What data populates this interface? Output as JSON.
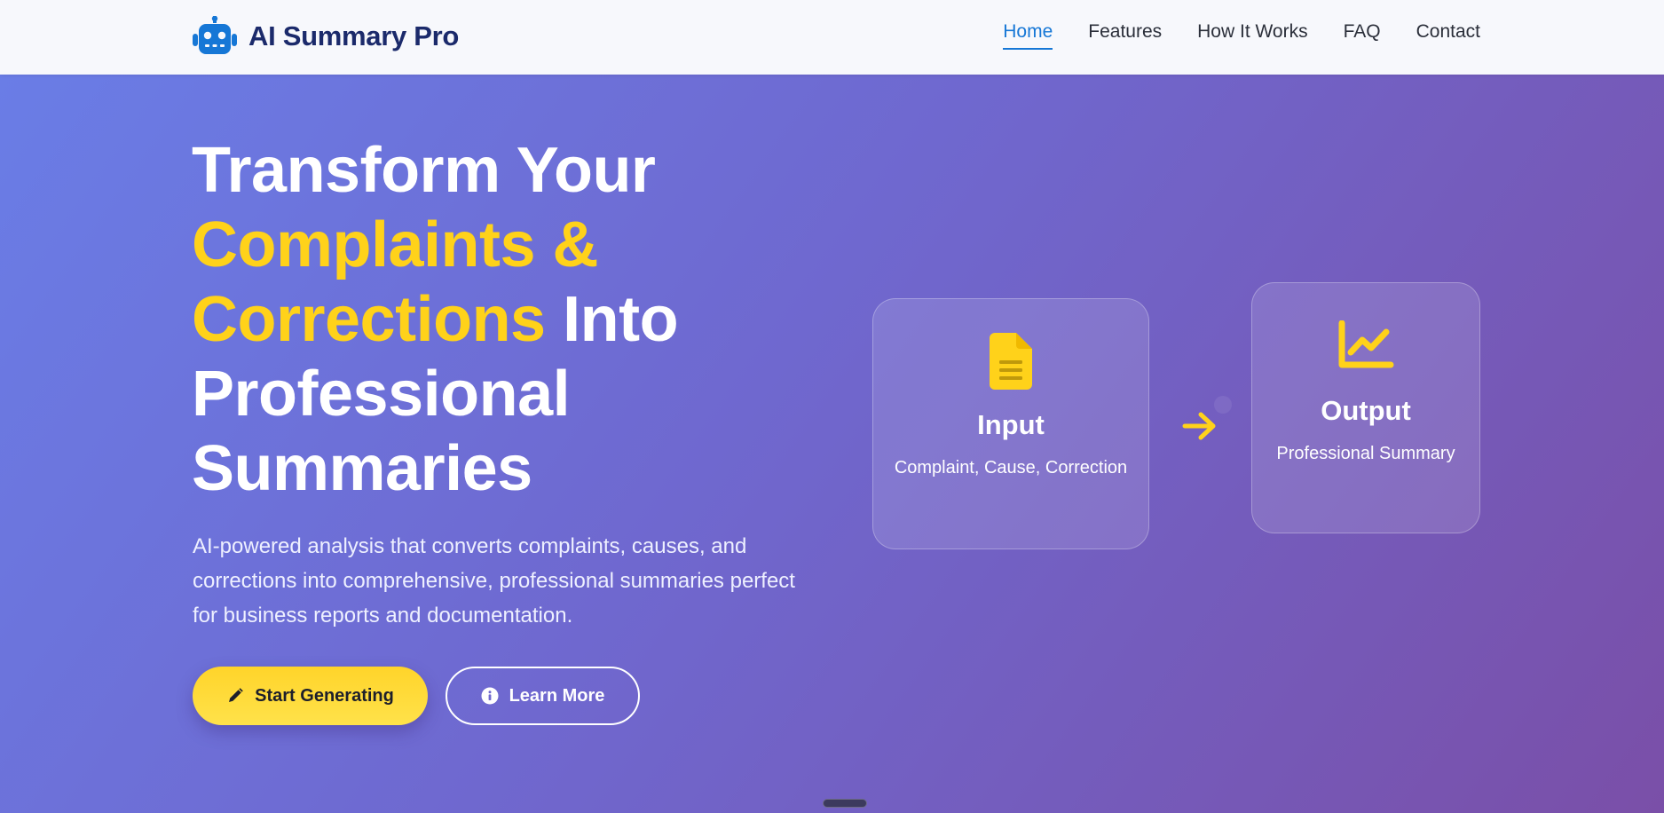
{
  "brand": {
    "name": "AI Summary Pro",
    "icon": "robot-icon",
    "icon_color": "#1677d6"
  },
  "nav": {
    "items": [
      {
        "label": "Home",
        "active": true
      },
      {
        "label": "Features",
        "active": false
      },
      {
        "label": "How It Works",
        "active": false
      },
      {
        "label": "FAQ",
        "active": false
      },
      {
        "label": "Contact",
        "active": false
      }
    ],
    "active_color": "#1677d6"
  },
  "hero": {
    "title_line1": "Transform Your",
    "title_highlight": "Complaints & Corrections",
    "title_line3": "Into Professional Summaries",
    "description": "AI-powered analysis that converts complaints, causes, and corrections into comprehensive, professional summaries perfect for business reports and documentation.",
    "primary_button": {
      "label": "Start Generating",
      "icon": "pencil-icon"
    },
    "secondary_button": {
      "label": "Learn More",
      "icon": "info-circle-icon"
    },
    "highlight_color": "#ffd21a",
    "gradient_start": "#6a7de6",
    "gradient_end": "#7a4fa8"
  },
  "flow": {
    "input": {
      "title": "Input",
      "subtitle": "Complaint, Cause, Correction",
      "icon": "document-icon"
    },
    "arrow_icon": "arrow-right-icon",
    "output": {
      "title": "Output",
      "subtitle": "Professional Summary",
      "icon": "chart-line-icon"
    },
    "icon_color": "#ffd21a"
  }
}
